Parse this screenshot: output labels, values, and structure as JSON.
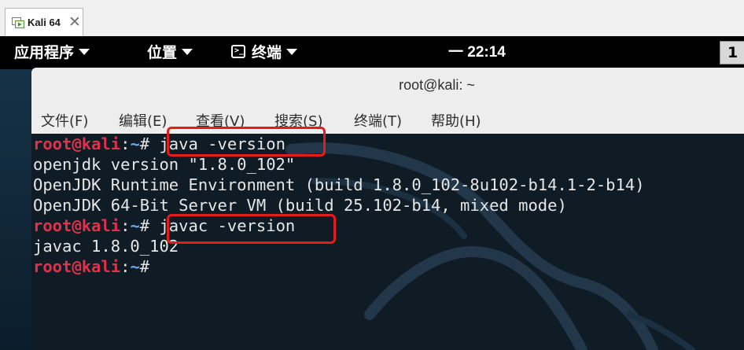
{
  "vmware": {
    "tab_label": "Kali 64",
    "close_glyph": "✕"
  },
  "gnome_bar": {
    "applications": "应用程序",
    "places": "位置",
    "terminal": "终端",
    "terminal_icon_glyph": ">_",
    "clock": "一 22:14",
    "right_indicator": "1"
  },
  "terminal_window": {
    "title": "root@kali: ~",
    "menu": {
      "file": "文件(F)",
      "edit": "编辑(E)",
      "view": "查看(V)",
      "search": "搜索(S)",
      "terminal": "终端(T)",
      "help": "帮助(H)"
    },
    "prompt": {
      "user": "root@kali",
      "sep": ":",
      "path": "~",
      "symbol": "# "
    },
    "lines": {
      "cmd1": "java -version",
      "out1": "openjdk version \"1.8.0_102\"",
      "out2": "OpenJDK Runtime Environment (build 1.8.0_102-8u102-b14.1-2-b14)",
      "out3": "OpenJDK 64-Bit Server VM (build 25.102-b14, mixed mode)",
      "cmd2": "javac -version",
      "out4": "javac 1.8.0_102"
    }
  },
  "colors": {
    "prompt_user": "#e0324a",
    "prompt_path": "#6fa4e6",
    "highlight_box": "#e11d1d",
    "terminal_bg": "#0f1c26"
  },
  "icons": {
    "vm_tab": "vm-play-icon",
    "terminal_app": "terminal-icon",
    "dropdown": "chevron-down-icon",
    "background": "kali-dragon-icon"
  }
}
